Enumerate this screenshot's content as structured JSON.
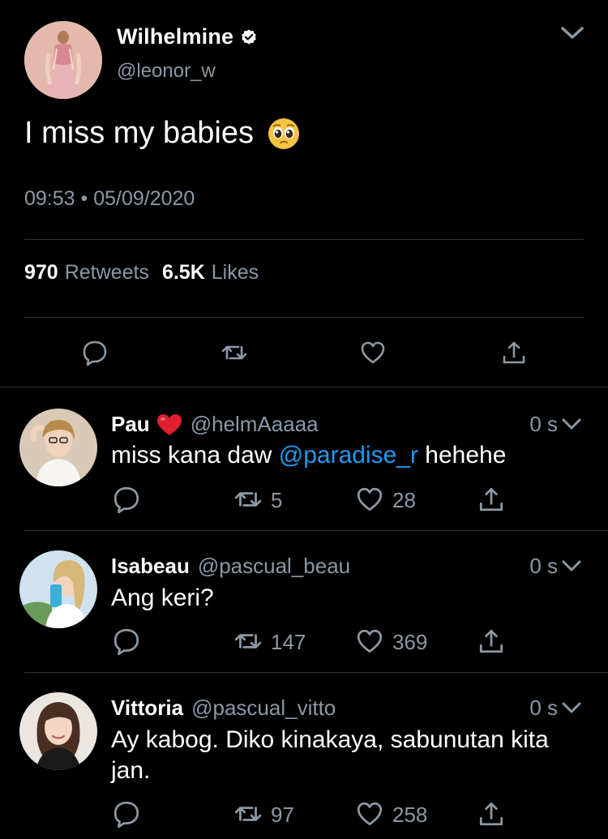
{
  "main_tweet": {
    "name": "Wilhelmine",
    "handle": "@leonor_w",
    "text": "I miss my babies",
    "timestamp": "09:53 • 05/09/2020",
    "retweets_count": "970",
    "retweets_label": "Retweets",
    "likes_count": "6.5K",
    "likes_label": "Likes",
    "icons": {
      "verified": "verified-badge-icon",
      "more": "chevron-down-icon",
      "reply": "reply-bubble-icon",
      "retweet": "retweet-icon",
      "like": "heart-outline-icon",
      "share": "share-icon"
    }
  },
  "replies": [
    {
      "name": "Pau",
      "handle": "@helmAaaaa",
      "time": "0 s",
      "text_before": "miss kana daw ",
      "mention": "@paradise_r",
      "text_after": " hehehe",
      "retweets": "5",
      "likes": "28"
    },
    {
      "name": "Isabeau",
      "handle": "@pascual_beau",
      "time": "0 s",
      "text_before": "Ang keri?",
      "mention": "",
      "text_after": "",
      "retweets": "147",
      "likes": "369"
    },
    {
      "name": "Vittoria",
      "handle": "@pascual_vitto",
      "time": "0 s",
      "text_before": "Ay kabog. Diko kinakaya, sabunutan kita jan.",
      "mention": "",
      "text_after": "",
      "retweets": "97",
      "likes": "258"
    }
  ],
  "colors": {
    "background": "#000000",
    "text_primary": "#ffffff",
    "text_secondary": "#8b98a5",
    "link": "#1d9bf0",
    "divider": "#2f3336",
    "verified": "#ffffff"
  }
}
